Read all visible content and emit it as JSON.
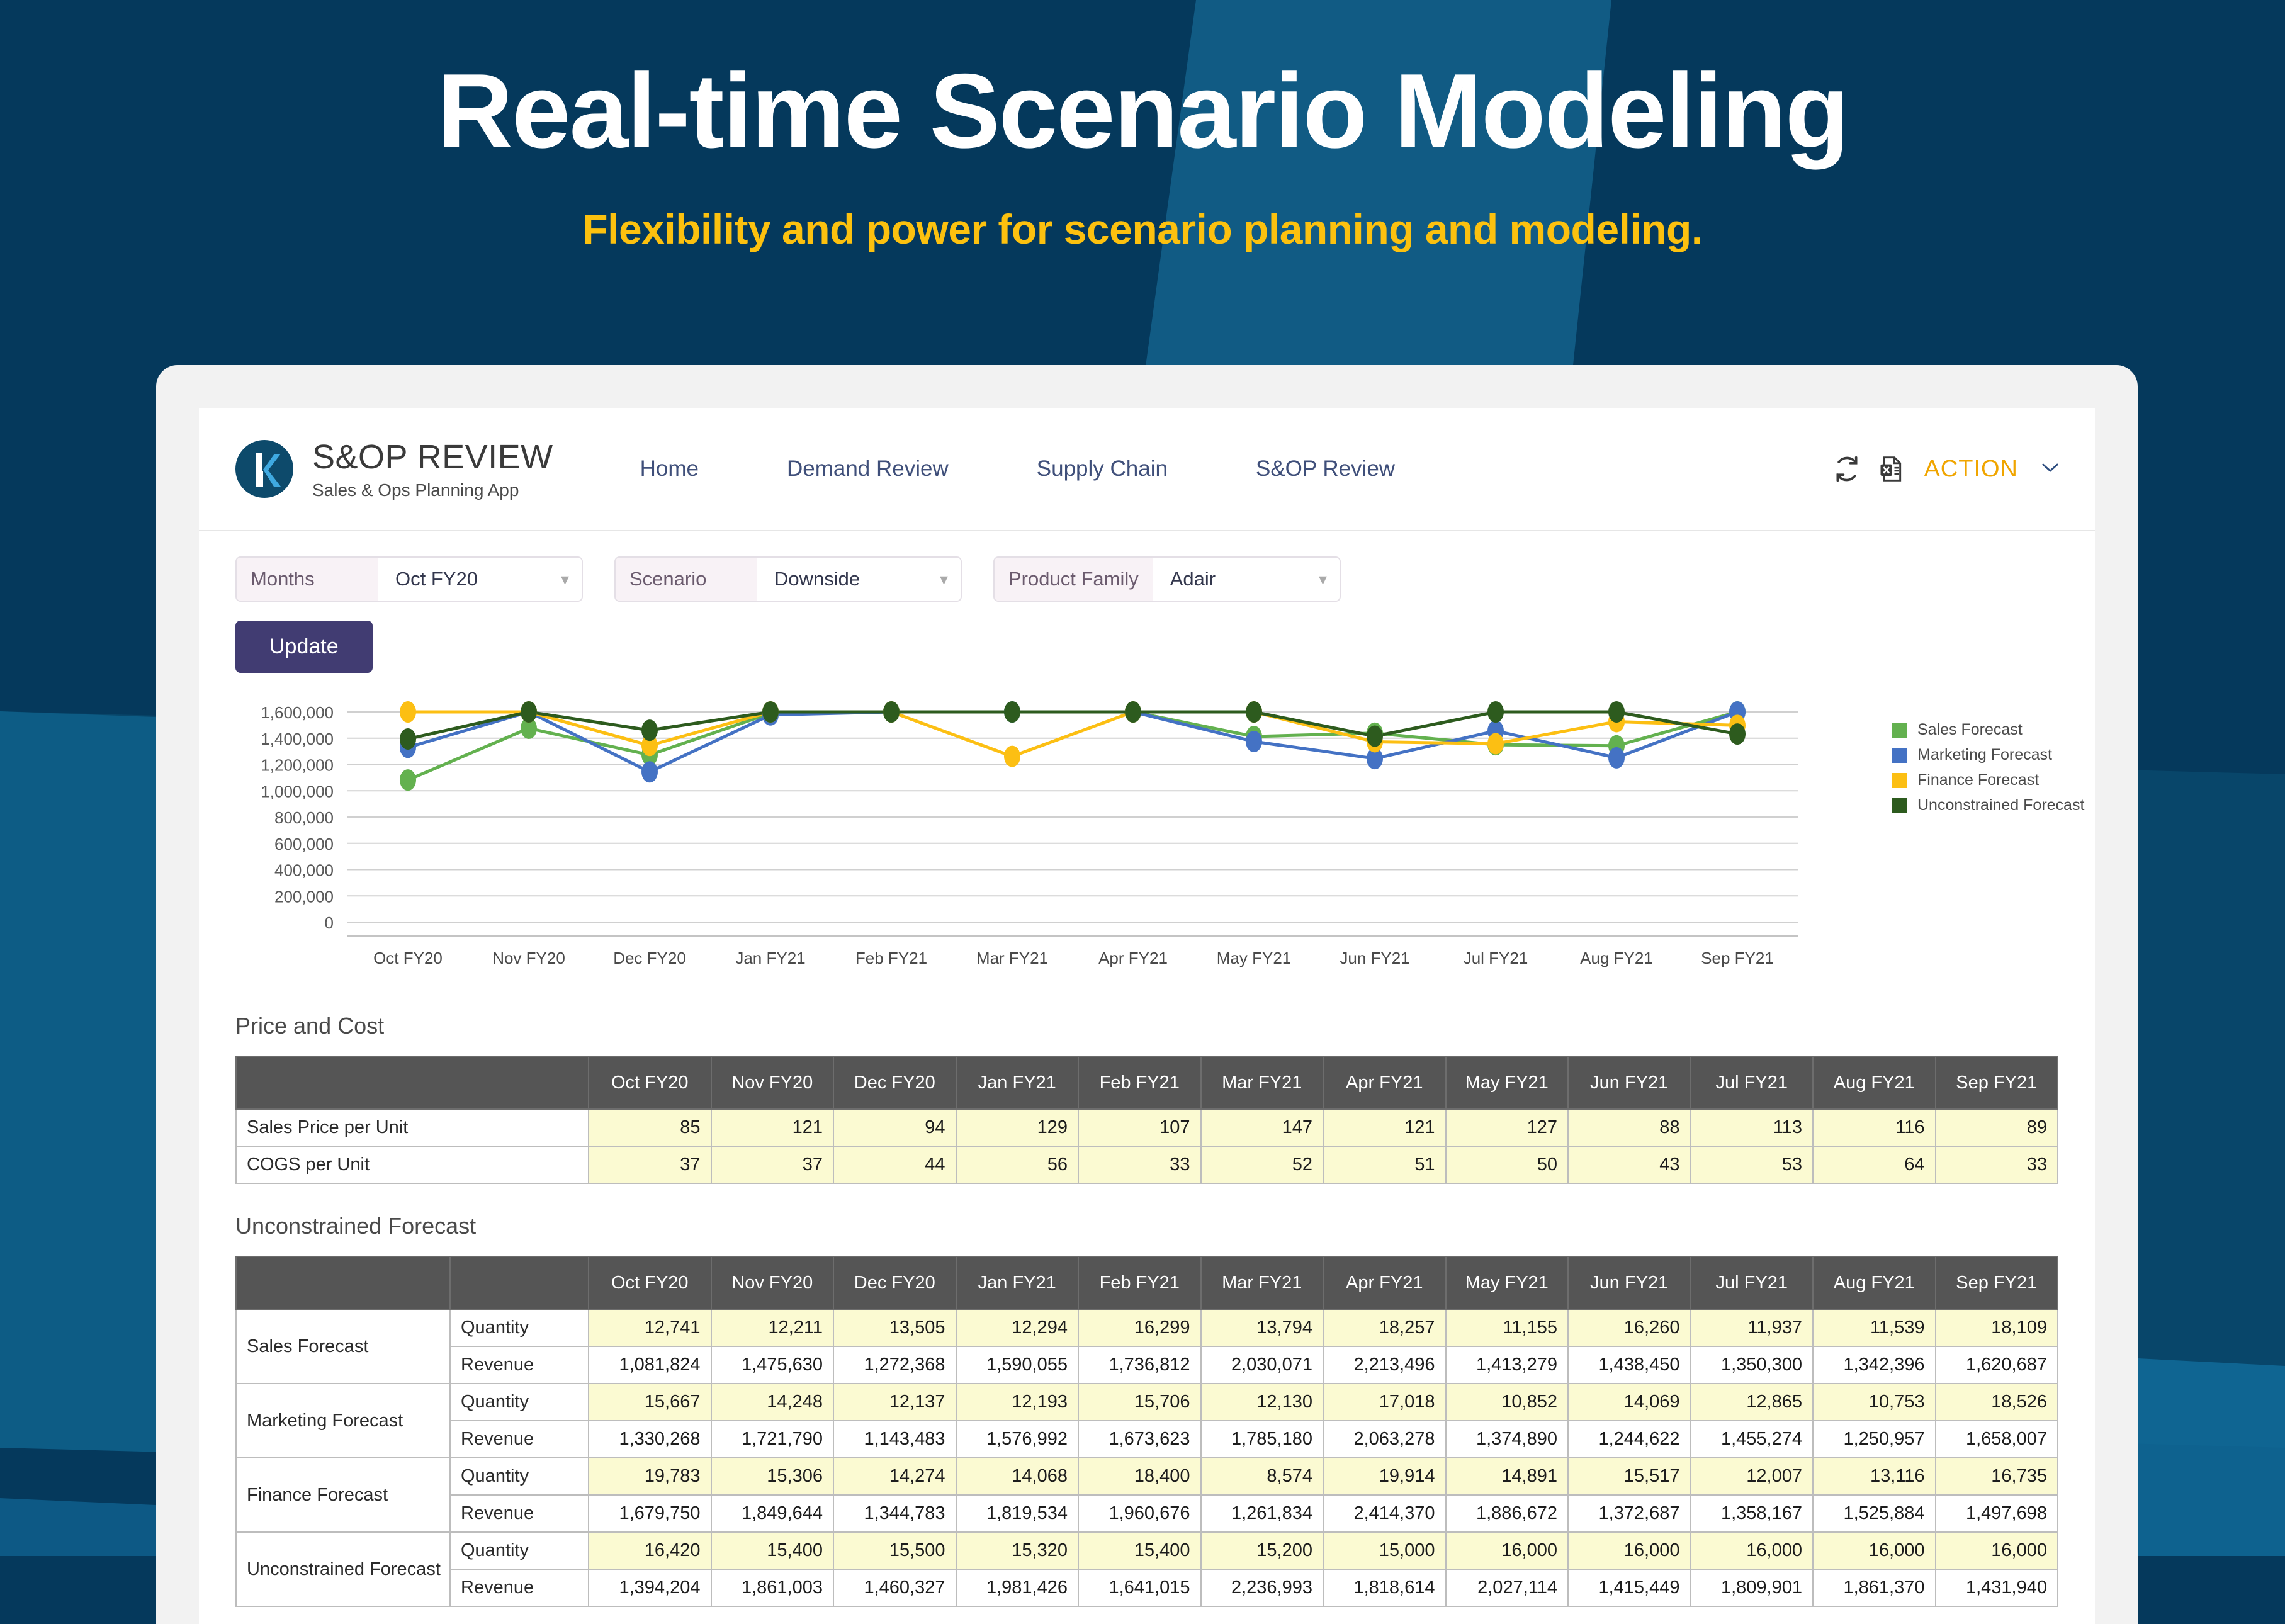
{
  "hero": {
    "title": "Real-time Scenario Modeling",
    "subtitle": "Flexibility and power for scenario planning and modeling.",
    "title_color": "#ffffff",
    "subtitle_color": "#fcc10f",
    "background_color": "#05395c",
    "band_color": "#115b84"
  },
  "app": {
    "brand": {
      "title": "S&OP REVIEW",
      "subtitle": "Sales & Ops Planning App",
      "logo_icon": "k-logo-icon",
      "logo_bg": "#0d4a6b",
      "logo_accent": "#3fa9e0"
    },
    "nav": [
      {
        "label": "Home"
      },
      {
        "label": "Demand Review"
      },
      {
        "label": "Supply Chain"
      },
      {
        "label": "S&OP Review"
      }
    ],
    "header_actions": {
      "refresh_icon": "refresh-icon",
      "excel_icon": "excel-export-icon",
      "action_label": "ACTION",
      "action_color": "#f0a500",
      "chevron_icon": "chevron-down-icon"
    },
    "filters": [
      {
        "label": "Months",
        "value": "Oct FY20"
      },
      {
        "label": "Scenario",
        "value": "Downside"
      },
      {
        "label": "Product Family",
        "value": "Adair"
      }
    ],
    "update_button": "Update"
  },
  "chart_data": {
    "type": "line",
    "title": "",
    "xlabel": "",
    "ylabel": "",
    "grid": true,
    "legend_position": "right",
    "ylim": [
      0,
      1600000
    ],
    "yticks": [
      0,
      200000,
      400000,
      600000,
      800000,
      1000000,
      1200000,
      1400000,
      1600000
    ],
    "ytick_labels": [
      "0",
      "200,000",
      "400,000",
      "600,000",
      "800,000",
      "1,000,000",
      "1,200,000",
      "1,400,000",
      "1,600,000"
    ],
    "categories": [
      "Oct FY20",
      "Nov FY20",
      "Dec FY20",
      "Jan FY21",
      "Feb FY21",
      "Mar FY21",
      "Apr FY21",
      "May FY21",
      "Jun FY21",
      "Jul FY21",
      "Aug FY21",
      "Sep FY21"
    ],
    "series": [
      {
        "name": "Sales Forecast",
        "color": "#63b14f",
        "values": [
          1081824,
          1475630,
          1272368,
          1590055,
          1736812,
          2030071,
          2213496,
          1413279,
          1438450,
          1350300,
          1342396,
          1620687
        ]
      },
      {
        "name": "Marketing Forecast",
        "color": "#4472c4",
        "values": [
          1330268,
          1721790,
          1143483,
          1576992,
          1673623,
          1785180,
          2063278,
          1374890,
          1244622,
          1455274,
          1250957,
          1658007
        ]
      },
      {
        "name": "Finance Forecast",
        "color": "#fcbf13",
        "values": [
          1679750,
          1849644,
          1344783,
          1819534,
          1960676,
          1261834,
          2414370,
          1886672,
          1372687,
          1358167,
          1525884,
          1497698
        ]
      },
      {
        "name": "Unconstrained Forecast",
        "color": "#2d5b1e",
        "values": [
          1394204,
          1861003,
          1460327,
          1981426,
          1641015,
          2236993,
          1818614,
          2027114,
          1415449,
          1809901,
          1861370,
          1431940
        ]
      }
    ]
  },
  "price_and_cost": {
    "title": "Price and Cost",
    "columns": [
      "Oct FY20",
      "Nov FY20",
      "Dec FY20",
      "Jan FY21",
      "Feb FY21",
      "Mar FY21",
      "Apr FY21",
      "May FY21",
      "Jun FY21",
      "Jul FY21",
      "Aug FY21",
      "Sep FY21"
    ],
    "rows": [
      {
        "label": "Sales Price per Unit",
        "values": [
          "85",
          "121",
          "94",
          "129",
          "107",
          "147",
          "121",
          "127",
          "88",
          "113",
          "116",
          "89"
        ]
      },
      {
        "label": "COGS per Unit",
        "values": [
          "37",
          "37",
          "44",
          "56",
          "33",
          "52",
          "51",
          "50",
          "43",
          "53",
          "64",
          "33"
        ]
      }
    ]
  },
  "unconstrained_forecast": {
    "title": "Unconstrained Forecast",
    "columns": [
      "Oct FY20",
      "Nov FY20",
      "Dec FY20",
      "Jan FY21",
      "Feb FY21",
      "Mar FY21",
      "Apr FY21",
      "May FY21",
      "Jun FY21",
      "Jul FY21",
      "Aug FY21",
      "Sep FY21"
    ],
    "groups": [
      {
        "label": "Sales Forecast",
        "rows": [
          {
            "label": "Quantity",
            "highlight": true,
            "values": [
              "12,741",
              "12,211",
              "13,505",
              "12,294",
              "16,299",
              "13,794",
              "18,257",
              "11,155",
              "16,260",
              "11,937",
              "11,539",
              "18,109"
            ]
          },
          {
            "label": "Revenue",
            "highlight": false,
            "values": [
              "1,081,824",
              "1,475,630",
              "1,272,368",
              "1,590,055",
              "1,736,812",
              "2,030,071",
              "2,213,496",
              "1,413,279",
              "1,438,450",
              "1,350,300",
              "1,342,396",
              "1,620,687"
            ]
          }
        ]
      },
      {
        "label": "Marketing Forecast",
        "rows": [
          {
            "label": "Quantity",
            "highlight": true,
            "values": [
              "15,667",
              "14,248",
              "12,137",
              "12,193",
              "15,706",
              "12,130",
              "17,018",
              "10,852",
              "14,069",
              "12,865",
              "10,753",
              "18,526"
            ]
          },
          {
            "label": "Revenue",
            "highlight": false,
            "values": [
              "1,330,268",
              "1,721,790",
              "1,143,483",
              "1,576,992",
              "1,673,623",
              "1,785,180",
              "2,063,278",
              "1,374,890",
              "1,244,622",
              "1,455,274",
              "1,250,957",
              "1,658,007"
            ]
          }
        ]
      },
      {
        "label": "Finance Forecast",
        "rows": [
          {
            "label": "Quantity",
            "highlight": true,
            "values": [
              "19,783",
              "15,306",
              "14,274",
              "14,068",
              "18,400",
              "8,574",
              "19,914",
              "14,891",
              "15,517",
              "12,007",
              "13,116",
              "16,735"
            ]
          },
          {
            "label": "Revenue",
            "highlight": false,
            "values": [
              "1,679,750",
              "1,849,644",
              "1,344,783",
              "1,819,534",
              "1,960,676",
              "1,261,834",
              "2,414,370",
              "1,886,672",
              "1,372,687",
              "1,358,167",
              "1,525,884",
              "1,497,698"
            ]
          }
        ]
      },
      {
        "label": "Unconstrained Forecast",
        "rows": [
          {
            "label": "Quantity",
            "highlight": true,
            "values": [
              "16,420",
              "15,400",
              "15,500",
              "15,320",
              "15,400",
              "15,200",
              "15,000",
              "16,000",
              "16,000",
              "16,000",
              "16,000",
              "16,000"
            ]
          },
          {
            "label": "Revenue",
            "highlight": false,
            "values": [
              "1,394,204",
              "1,861,003",
              "1,460,327",
              "1,981,426",
              "1,641,015",
              "2,236,993",
              "1,818,614",
              "2,027,114",
              "1,415,449",
              "1,809,901",
              "1,861,370",
              "1,431,940"
            ]
          }
        ]
      }
    ]
  }
}
